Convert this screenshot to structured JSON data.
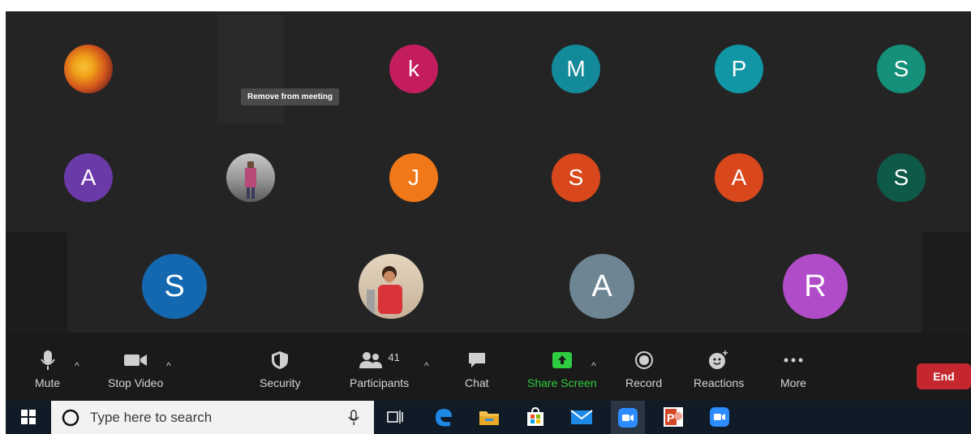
{
  "tooltip": "Remove from meeting",
  "participants": [
    {
      "initial": "",
      "color": "#c8681a",
      "kind": "photo-flower"
    },
    {
      "initial": "k",
      "color": "#c41d5f"
    },
    {
      "initial": "M",
      "color": "#138a9a"
    },
    {
      "initial": "P",
      "color": "#1196a6"
    },
    {
      "initial": "S",
      "color": "#139077"
    },
    {
      "initial": "A",
      "color": "#6a3aa8"
    },
    {
      "initial": "",
      "color": "#8a8a8a",
      "kind": "photo-person"
    },
    {
      "initial": "J",
      "color": "#f07818"
    },
    {
      "initial": "S",
      "color": "#d8481c"
    },
    {
      "initial": "A",
      "color": "#d8481c"
    },
    {
      "initial": "S",
      "color": "#0e5a48"
    },
    {
      "initial": "S",
      "color": "#1368b0"
    },
    {
      "initial": "",
      "color": "#d04040",
      "kind": "photo-girl"
    },
    {
      "initial": "A",
      "color": "#6e8594"
    },
    {
      "initial": "R",
      "color": "#b04cc8"
    }
  ],
  "toolbar": {
    "mute": "Mute",
    "stop_video": "Stop Video",
    "security": "Security",
    "participants": "Participants",
    "participants_count": "41",
    "chat": "Chat",
    "share_screen": "Share Screen",
    "record": "Record",
    "reactions": "Reactions",
    "more": "More",
    "end": "End"
  },
  "colors": {
    "share_screen": "#2ecc40",
    "end": "#c4282e"
  },
  "taskbar": {
    "search_placeholder": "Type here to search",
    "icons": [
      "windows-start-icon",
      "task-view-icon",
      "edge-icon",
      "file-explorer-icon",
      "store-icon",
      "mail-icon",
      "zoom-icon",
      "powerpoint-icon",
      "zoom-icon"
    ]
  }
}
